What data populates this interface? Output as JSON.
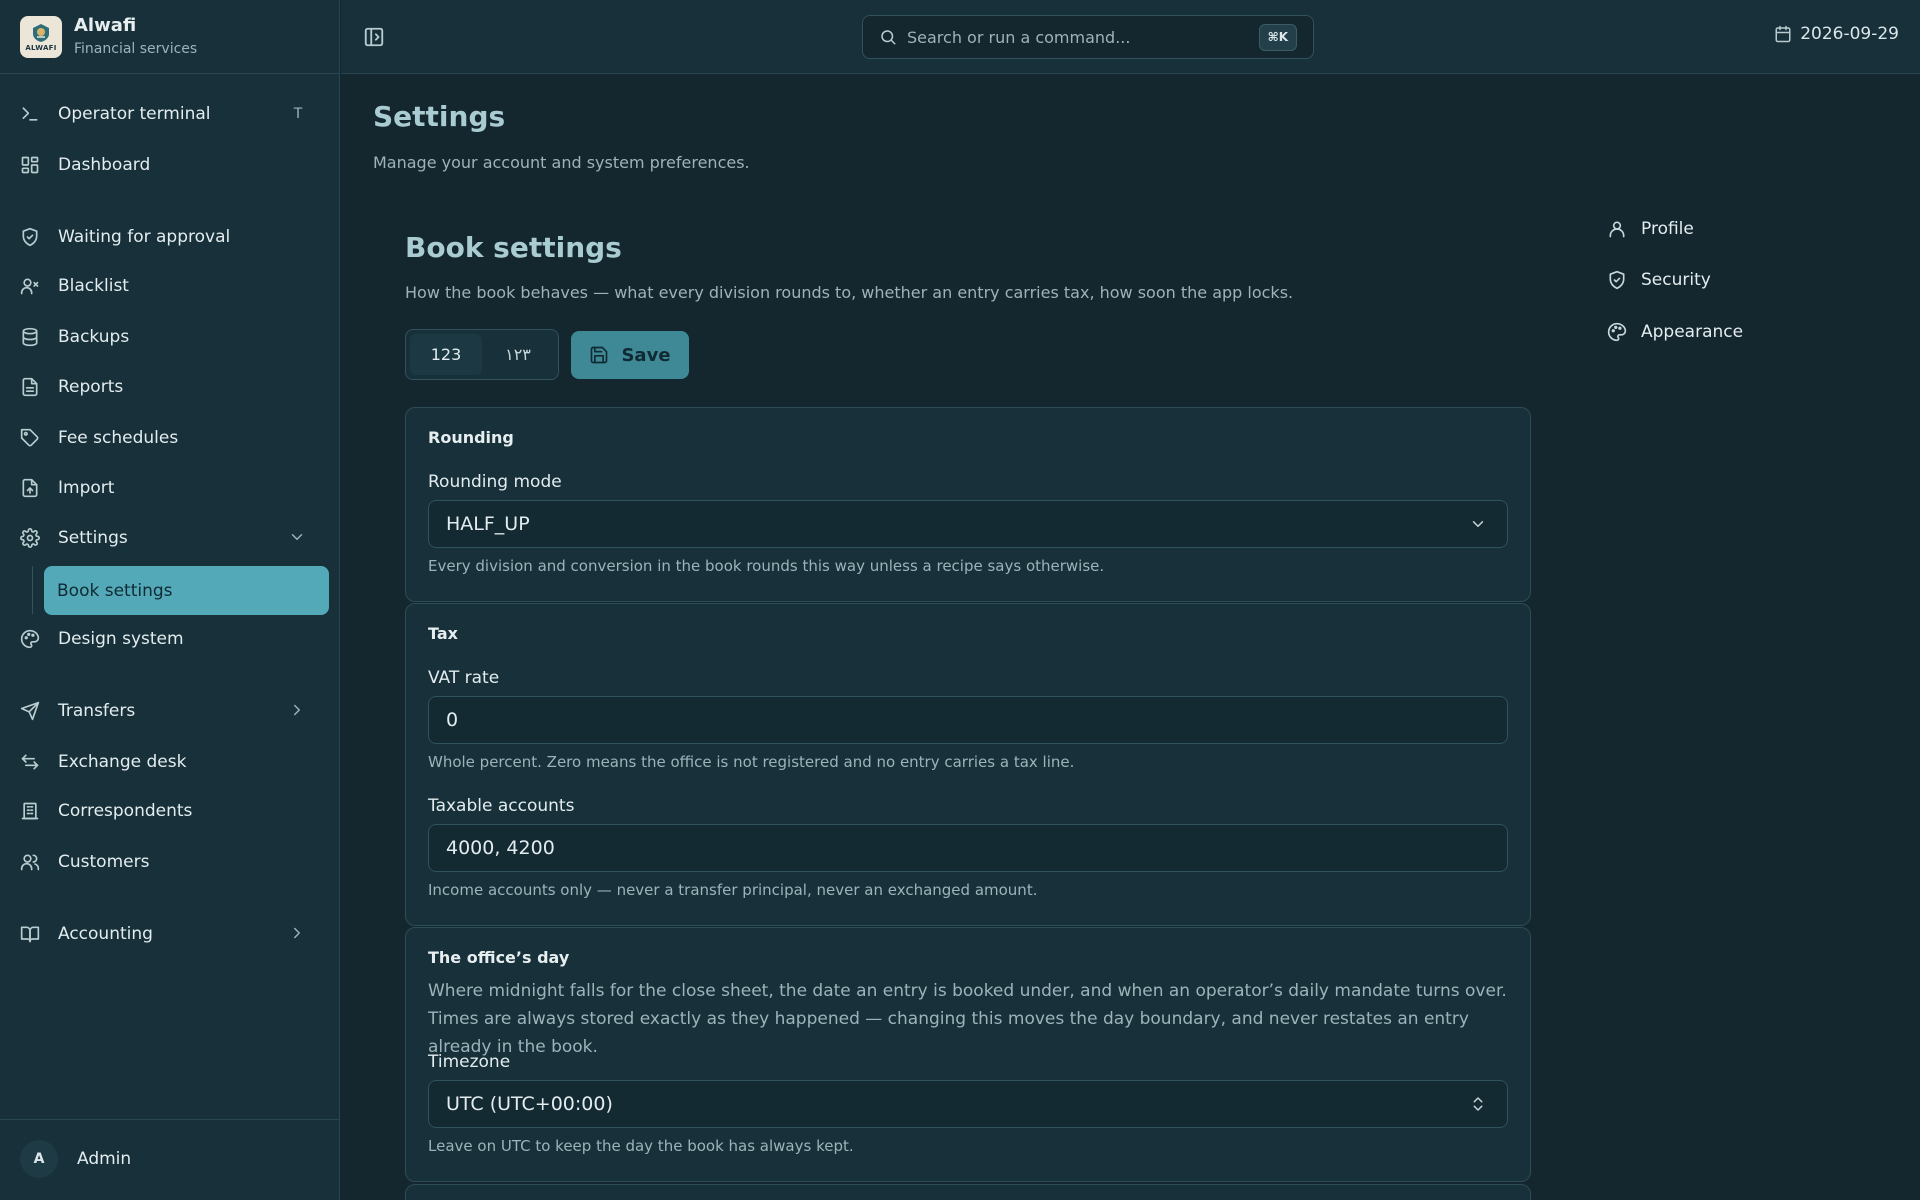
{
  "brand": {
    "name": "Alwafi",
    "subtitle": "Financial services",
    "logo_text": "ALWAFI"
  },
  "sidebar": {
    "items": [
      {
        "label": "Operator terminal",
        "icon": "terminal-icon",
        "shortcut": "T"
      },
      {
        "label": "Dashboard",
        "icon": "dashboard-icon"
      },
      {
        "label": "Waiting for approval",
        "icon": "shield-check-icon"
      },
      {
        "label": "Blacklist",
        "icon": "user-x-icon"
      },
      {
        "label": "Backups",
        "icon": "database-icon"
      },
      {
        "label": "Reports",
        "icon": "file-text-icon"
      },
      {
        "label": "Fee schedules",
        "icon": "tag-icon"
      },
      {
        "label": "Import",
        "icon": "file-upload-icon"
      },
      {
        "label": "Settings",
        "icon": "gear-icon",
        "expanded": true
      },
      {
        "label": "Design system",
        "icon": "palette-icon"
      },
      {
        "label": "Transfers",
        "icon": "send-icon"
      },
      {
        "label": "Exchange desk",
        "icon": "arrows-exchange-icon"
      },
      {
        "label": "Correspondents",
        "icon": "building-icon"
      },
      {
        "label": "Customers",
        "icon": "users-icon"
      },
      {
        "label": "Accounting",
        "icon": "book-icon"
      }
    ],
    "active_sub": "Book settings",
    "user": {
      "initial": "A",
      "name": "Admin"
    }
  },
  "topbar": {
    "search_placeholder": "Search or run a command...",
    "search_shortcut": "⌘K",
    "date": "2026-09-29"
  },
  "page": {
    "title": "Settings",
    "subtitle": "Manage your account and system preferences."
  },
  "section": {
    "title": "Book settings",
    "description": "How the book behaves — what every division rounds to, whether an entry carries tax, how soon the app locks.",
    "numerals": {
      "latin": "123",
      "arabic": "١٢٣",
      "selected": "latin"
    },
    "save_label": "Save"
  },
  "rounding": {
    "title": "Rounding",
    "mode_label": "Rounding mode",
    "mode_value": "HALF_UP",
    "mode_help": "Every division and conversion in the book rounds this way unless a recipe says otherwise."
  },
  "tax": {
    "title": "Tax",
    "vat_label": "VAT rate",
    "vat_value": "0",
    "vat_help": "Whole percent. Zero means the office is not registered and no entry carries a tax line.",
    "accounts_label": "Taxable accounts",
    "accounts_value": "4000, 4200",
    "accounts_help": "Income accounts only — never a transfer principal, never an exchanged amount."
  },
  "office_day": {
    "title": "The office’s day",
    "description": "Where midnight falls for the close sheet, the date an entry is booked under, and when an operator’s daily mandate turns over. Times are always stored exactly as they happened — changing this moves the day boundary, and never restates an entry already in the book.",
    "tz_label": "Timezone",
    "tz_value": "UTC (UTC+00:00)",
    "tz_help": "Leave on UTC to keep the day the book has always kept."
  },
  "right_nav": [
    {
      "label": "Profile",
      "icon": "user-icon"
    },
    {
      "label": "Security",
      "icon": "shield-check-icon"
    },
    {
      "label": "Appearance",
      "icon": "palette-icon"
    }
  ],
  "colors": {
    "background": "#14262e",
    "sidebar": "#17303a",
    "accent": "#54a9b8",
    "save_button": "#3f8996",
    "heading": "#a9cbd2"
  }
}
